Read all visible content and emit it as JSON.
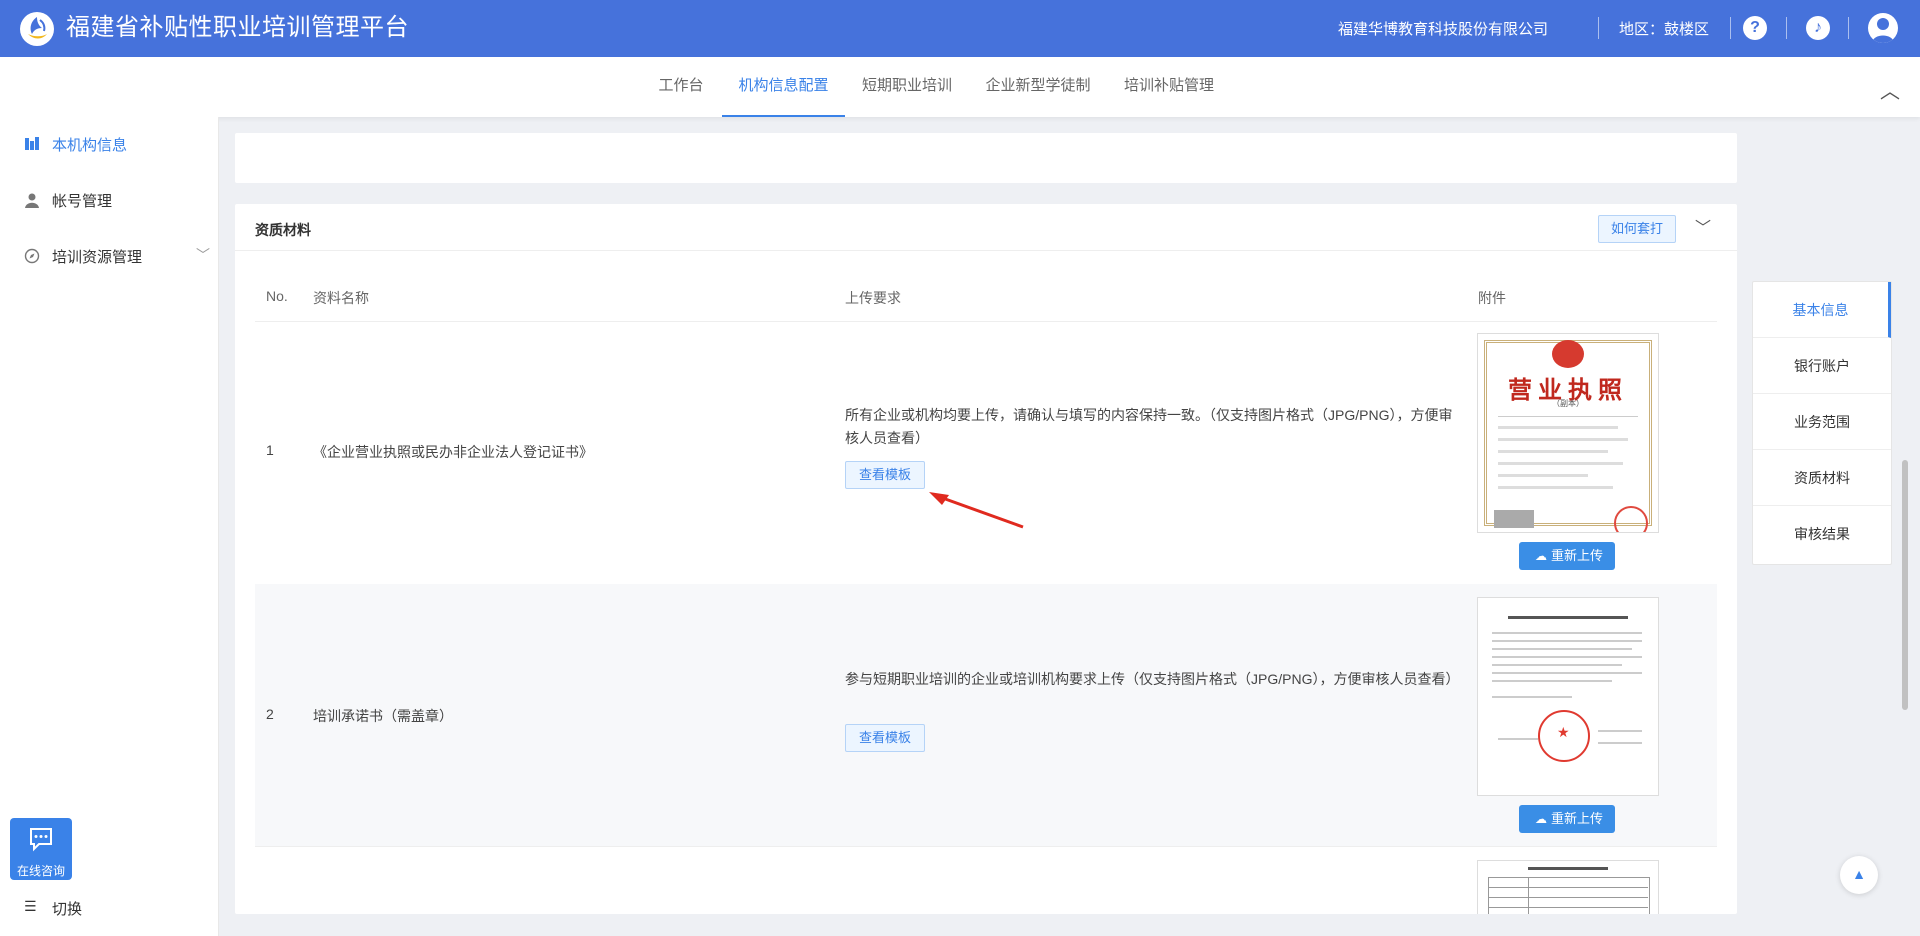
{
  "header": {
    "app_title": "福建省补贴性职业培训管理平台",
    "company": "福建华博教育科技股份有限公司",
    "region": "地区：鼓楼区",
    "icons": [
      "help-icon",
      "tiktok-icon",
      "user-avatar-icon"
    ],
    "accent": "#4672db"
  },
  "nav": {
    "tabs": [
      "工作台",
      "机构信息配置",
      "短期职业培训",
      "企业新型学徒制",
      "培训补贴管理"
    ],
    "active_tab": "机构信息配置"
  },
  "sidebar": {
    "items": [
      {
        "label": "本机构信息",
        "icon": "building-icon",
        "active": true
      },
      {
        "label": "帐号管理",
        "icon": "user-icon",
        "active": false
      },
      {
        "label": "培训资源管理",
        "icon": "compass-icon",
        "active": false
      }
    ],
    "consult_label": "在线咨询",
    "switch_label": "切换"
  },
  "section": {
    "title": "资质材料",
    "how_button": "如何套打",
    "columns": [
      "No.",
      "资料名称",
      "上传要求",
      "附件"
    ],
    "rows": [
      {
        "no": "1",
        "name": "《企业营业执照或民办非企业法人登记证书》",
        "requirement": "所有企业或机构均要上传，请确认与填写的内容保持一致。（仅支持图片格式（JPG/PNG），方便审核人员查看）",
        "template_button": "查看模板",
        "reupload_button": "重新上传",
        "thumb_title": "营业执照",
        "thumb_sub": "（副本）"
      },
      {
        "no": "2",
        "name": "培训承诺书（需盖章）",
        "requirement": "参与短期职业培训的企业或培训机构要求上传（仅支持图片格式（JPG/PNG），方便审核人员查看）",
        "template_button": "查看模板",
        "reupload_button": "重新上传"
      }
    ]
  },
  "anchor_nav": {
    "items": [
      "基本信息",
      "银行账户",
      "业务范围",
      "资质材料",
      "审核结果"
    ],
    "active": "基本信息"
  }
}
